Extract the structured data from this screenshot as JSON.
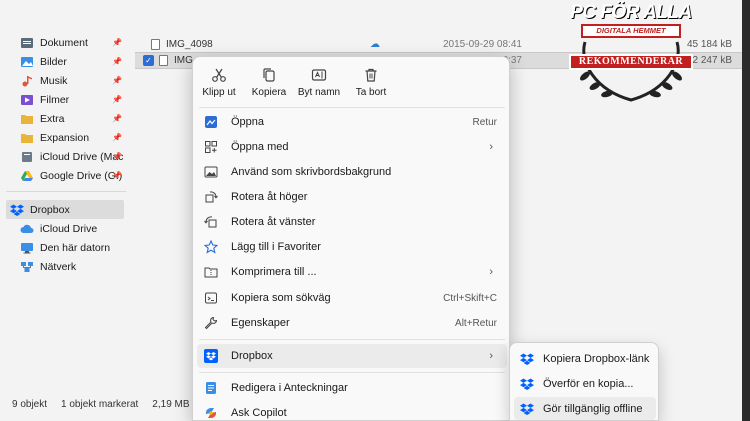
{
  "sidebar": {
    "items": [
      {
        "label": "Dokument",
        "icon": "documents-icon",
        "color": "#5b6b7a",
        "pinned": true
      },
      {
        "label": "Bilder",
        "icon": "pictures-icon",
        "color": "#3a8ee6",
        "pinned": true
      },
      {
        "label": "Musik",
        "icon": "music-icon",
        "color": "#e0553b",
        "pinned": true
      },
      {
        "label": "Filmer",
        "icon": "videos-icon",
        "color": "#7a4fd0",
        "pinned": true
      },
      {
        "label": "Extra",
        "icon": "folder-icon",
        "color": "#e8b53a",
        "pinned": true
      },
      {
        "label": "Expansion",
        "icon": "folder-icon",
        "color": "#e8b53a",
        "pinned": true
      },
      {
        "label": "iCloud Drive (Mac",
        "icon": "icloud-drive-icon",
        "color": "#6b7b8a",
        "pinned": true
      },
      {
        "label": "Google Drive (G:)",
        "icon": "google-drive-icon",
        "color": "#34a853",
        "pinned": true
      }
    ],
    "lower_items": [
      {
        "label": "Dropbox",
        "icon": "dropbox-icon",
        "color": "#0061fe",
        "selected": true
      },
      {
        "label": "iCloud Drive",
        "icon": "icloud-icon",
        "color": "#3a8ee6"
      },
      {
        "label": "Den här datorn",
        "icon": "this-pc-icon",
        "color": "#3a8ee6"
      },
      {
        "label": "Nätverk",
        "icon": "network-icon",
        "color": "#3a8ee6"
      }
    ]
  },
  "files": [
    {
      "name": "IMG_4098",
      "date": "2015-09-29 08:41",
      "size": "45 184 kB",
      "selected": false
    },
    {
      "name": "IMG_4097",
      "date": "2015-09-29 08:37",
      "size": "2 247 kB",
      "selected": true
    }
  ],
  "status": {
    "count": "9 objekt",
    "selected": "1 objekt markerat",
    "size": "2,19 MB"
  },
  "badge": {
    "title": "PC FÖR ALLA",
    "subtitle": "DIGITALA HEMMET",
    "banner": "REKOMMENDERAR"
  },
  "context_menu": {
    "quick_actions": [
      {
        "label": "Klipp ut",
        "icon": "cut-icon"
      },
      {
        "label": "Kopiera",
        "icon": "copy-icon"
      },
      {
        "label": "Byt namn",
        "icon": "rename-icon"
      },
      {
        "label": "Ta bort",
        "icon": "delete-icon"
      }
    ],
    "items": [
      {
        "label": "Öppna",
        "shortcut": "Retur",
        "icon": "open-icon"
      },
      {
        "label": "Öppna med",
        "shortcut": "",
        "icon": "open-with-icon",
        "arrow": true
      },
      {
        "label": "Använd som skrivbordsbakgrund",
        "shortcut": "",
        "icon": "wallpaper-icon"
      },
      {
        "label": "Rotera åt höger",
        "shortcut": "",
        "icon": "rotate-right-icon"
      },
      {
        "label": "Rotera åt vänster",
        "shortcut": "",
        "icon": "rotate-left-icon"
      },
      {
        "label": "Lägg till i Favoriter",
        "shortcut": "",
        "icon": "star-icon"
      },
      {
        "label": "Komprimera till ...",
        "shortcut": "",
        "icon": "zip-icon",
        "arrow": true
      },
      {
        "label": "Kopiera som sökväg",
        "shortcut": "Ctrl+Skift+C",
        "icon": "copy-path-icon"
      },
      {
        "label": "Egenskaper",
        "shortcut": "Alt+Retur",
        "icon": "properties-icon"
      },
      {
        "label": "Dropbox",
        "shortcut": "",
        "icon": "dropbox-icon",
        "arrow": true
      },
      {
        "label": "Redigera i Anteckningar",
        "shortcut": "",
        "icon": "notepad-icon"
      },
      {
        "label": "Ask Copilot",
        "shortcut": "",
        "icon": "copilot-icon"
      }
    ]
  },
  "dropbox_submenu": {
    "items": [
      {
        "label": "Kopiera Dropbox-länk",
        "icon": "dropbox-icon"
      },
      {
        "label": "Överför en kopia...",
        "icon": "dropbox-icon"
      },
      {
        "label": "Gör tillgänglig offline",
        "icon": "dropbox-icon"
      }
    ]
  },
  "colors": {
    "accent": "#2b6cd6",
    "dropbox": "#0061fe",
    "badge_red": "#c21f1f"
  }
}
